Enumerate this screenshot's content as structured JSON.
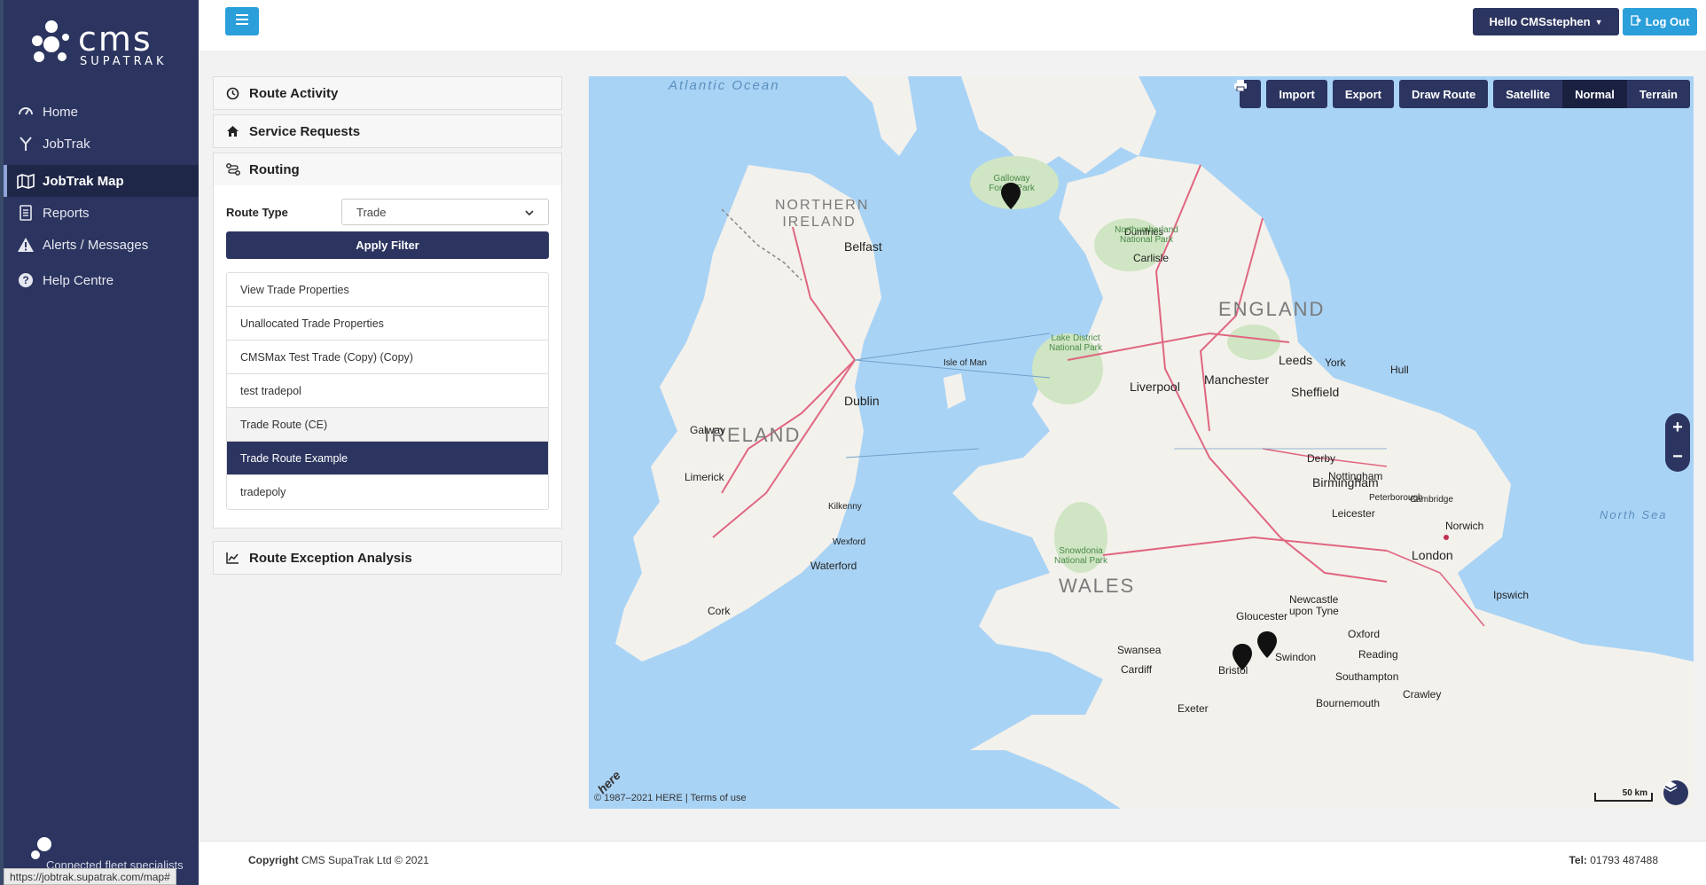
{
  "brand": {
    "name": "cms",
    "tagline": "SUPATRAK",
    "footer_tagline": "Connected fleet specialists"
  },
  "nav": {
    "items": [
      {
        "label": "Home",
        "icon": "dashboard-icon"
      },
      {
        "label": "JobTrak",
        "icon": "jobtrak-icon"
      },
      {
        "label": "JobTrak Map",
        "icon": "map-icon",
        "active": true
      },
      {
        "label": "Reports",
        "icon": "reports-icon"
      },
      {
        "label": "Alerts / Messages",
        "icon": "warning-icon"
      },
      {
        "label": "Help Centre",
        "icon": "help-icon"
      }
    ]
  },
  "status_url": "https://jobtrak.supatrak.com/map#",
  "header": {
    "user_label": "Hello CMSstephen",
    "logout_label": "Log Out"
  },
  "panels": {
    "route_activity": "Route Activity",
    "service_requests": "Service Requests",
    "routing": "Routing",
    "route_exception": "Route Exception Analysis"
  },
  "routing": {
    "route_type_label": "Route Type",
    "route_type_value": "Trade",
    "apply_label": "Apply Filter",
    "routes": [
      "View Trade Properties",
      "Unallocated Trade Properties",
      "CMSMax Test Trade (Copy) (Copy)",
      "test tradepol",
      "Trade Route (CE)",
      "Trade Route Example",
      "tradepoly"
    ],
    "selected_index": 5,
    "hover_index": 4
  },
  "map": {
    "toolbar": {
      "import": "Import",
      "export": "Export",
      "draw_route": "Draw Route",
      "satellite": "Satellite",
      "normal": "Normal",
      "terrain": "Terrain"
    },
    "active_mode": "Normal",
    "zoom_in": "+",
    "zoom_out": "−",
    "copyright": "© 1987–2021 HERE | Terms of use",
    "logo": "here",
    "scale": "50 km",
    "labels": {
      "atlantic": "Atlantic Ocean",
      "north_sea": "North Sea",
      "northern_ireland": "NORTHERN IRELAND",
      "ireland": "IRELAND",
      "england": "ENGLAND",
      "wales": "WALES",
      "dublin": "Dublin",
      "belfast": "Belfast",
      "london": "London",
      "birmingham": "Birmingham",
      "manchester": "Manchester",
      "liverpool": "Liverpool",
      "leeds": "Leeds",
      "bristol": "Bristol",
      "swindon": "Swindon",
      "cardiff": "Cardiff",
      "cork": "Cork",
      "newcastle": "Newcastle upon Tyne",
      "nottingham": "Nottingham",
      "southampton": "Southampton",
      "galloway": "Galloway Forest Park",
      "northumberland": "Northumberland National Park",
      "lake_district": "Lake District National Park",
      "snowdonia": "Snowdonia National Park",
      "sheffield": "Sheffield",
      "york": "York",
      "hull": "Hull",
      "gloucester": "Gloucester",
      "oxford": "Oxford",
      "reading": "Reading",
      "limerick": "Limerick",
      "waterford": "Waterford",
      "galway": "Galway",
      "norwich": "Norwich",
      "ipswich": "Ipswich",
      "brighton": "Crawley",
      "exeter": "Exeter",
      "derby": "Derby",
      "leicester": "Leicester",
      "isle_of_man": "Isle of Man",
      "carlisle": "Carlisle",
      "dumfries": "Dumfries",
      "kilkenny": "Kilkenny",
      "wexford": "Wexford",
      "swansea": "Swansea",
      "bournemouth": "Bournemouth",
      "peterborough": "Peterborough",
      "cambridge": "Cambridge"
    },
    "pins": [
      "pin-galloway",
      "pin-bristol",
      "pin-swindon"
    ]
  },
  "footer": {
    "copyright_bold": "Copyright",
    "copyright_rest": "CMS SupaTrak Ltd © 2021",
    "tel_bold": "Tel:",
    "tel_rest": "01793 487488"
  }
}
